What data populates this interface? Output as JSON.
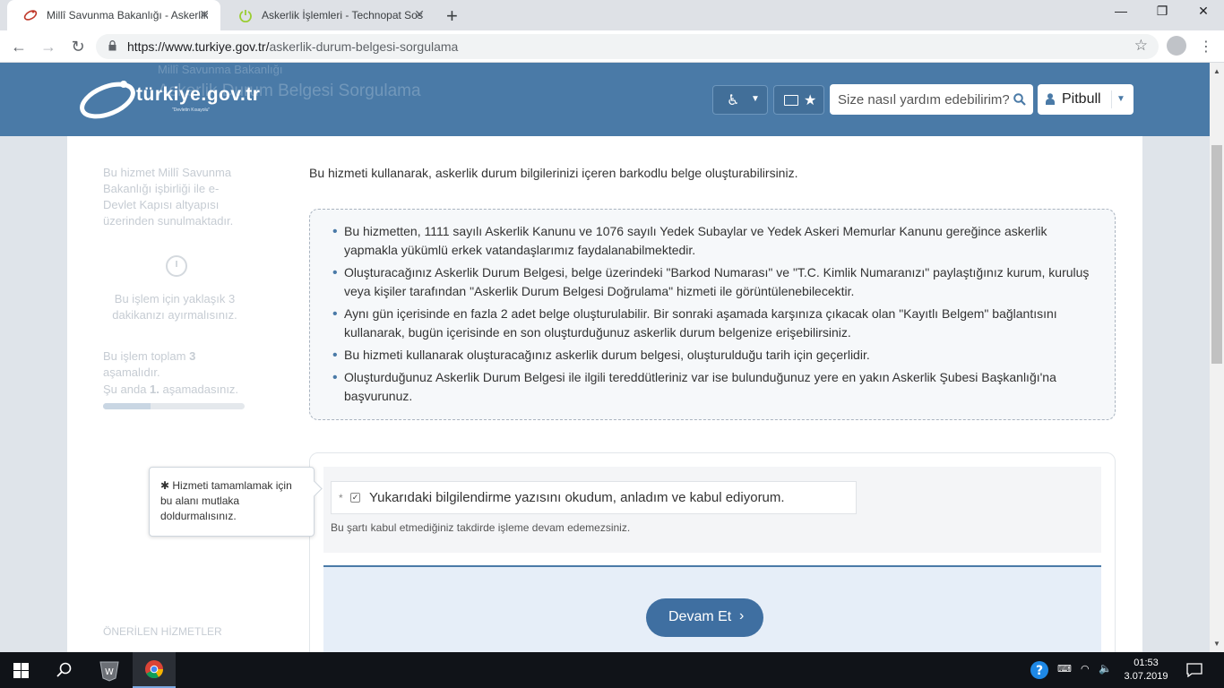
{
  "browser": {
    "tabs": [
      {
        "label": "Millî Savunma Bakanlığı - Askerlik",
        "active": true
      },
      {
        "label": "Askerlik İşlemleri - Technopat Sos",
        "active": false
      }
    ],
    "url_domain": "https://www.turkiye.gov.tr/",
    "url_path": "askerlik-durum-belgesi-sorgulama"
  },
  "header": {
    "ghost_ministry": "Millî Savunma Bakanlığı",
    "ghost_title": "Askerlik Durum Belgesi Sorgulama",
    "logo_text": "türkiye.gov.tr",
    "logo_sub": "\"Devletin Kısayolu\"",
    "search_placeholder": "Size nasıl yardım edebilirim?",
    "user_name": "Pitbull"
  },
  "sidebar": {
    "service_info": "Bu hizmet Millî Savunma Bakanlığı işbirliği ile e-Devlet Kapısı altyapısı üzerinden sunulmaktadır.",
    "time_info": "Bu işlem için yaklaşık 3 dakikanızı ayırmalısınız.",
    "steps_total_prefix": "Bu işlem toplam ",
    "steps_total": "3",
    "steps_total_suffix": " aşamalıdır.",
    "steps_current_prefix": "Şu anda ",
    "steps_current": "1.",
    "steps_current_suffix": " aşamadasınız.",
    "progress_fraction": 0.333,
    "recommended_title": "ÖNERİLEN HİZMETLER"
  },
  "main": {
    "intro": "Bu hizmeti kullanarak, askerlik durum bilgilerinizi içeren barkodlu belge oluşturabilirsiniz.",
    "info_items": [
      "Bu hizmetten, 1111 sayılı Askerlik Kanunu ve 1076 sayılı Yedek Subaylar ve Yedek Askeri Memurlar Kanunu gereğince askerlik yapmakla yükümlü erkek vatandaşlarımız faydalanabilmektedir.",
      "Oluşturacağınız Askerlik Durum Belgesi, belge üzerindeki \"Barkod Numarası\" ve \"T.C. Kimlik Numaranızı\" paylaştığınız kurum, kuruluş veya kişiler tarafından \"Askerlik Durum Belgesi Doğrulama\" hizmeti ile görüntülenebilecektir.",
      "Aynı gün içerisinde en fazla 2 adet belge oluşturulabilir. Bir sonraki aşamada karşınıza çıkacak olan \"Kayıtlı Belgem\" bağlantısını kullanarak, bugün içerisinde en son oluşturduğunuz askerlik durum belgenize erişebilirsiniz.",
      "Bu hizmeti kullanarak oluşturacağınız askerlik durum belgesi, oluşturulduğu tarih için geçerlidir.",
      "Oluşturduğunuz Askerlik Durum Belgesi ile ilgili tereddütleriniz var ise bulunduğunuz yere en yakın Askerlik Şubesi Başkanlığı'na başvurunuz."
    ],
    "required_mark": "*",
    "checkbox_label": "Yukarıdaki bilgilendirme yazısını okudum, anladım ve kabul ediyorum.",
    "checkbox_checked": true,
    "condition_note": "Bu şartı kabul etmediğiniz takdirde işleme devam edemezsiniz.",
    "continue_label": "Devam Et"
  },
  "tooltip": {
    "text": "✱ Hizmeti tamamlamak için bu alanı mutlaka doldurmalısınız."
  },
  "taskbar": {
    "time": "01:53",
    "date": "3.07.2019"
  },
  "colors": {
    "brand_blue": "#4a7aa7",
    "button_blue": "#3f6fa1"
  }
}
